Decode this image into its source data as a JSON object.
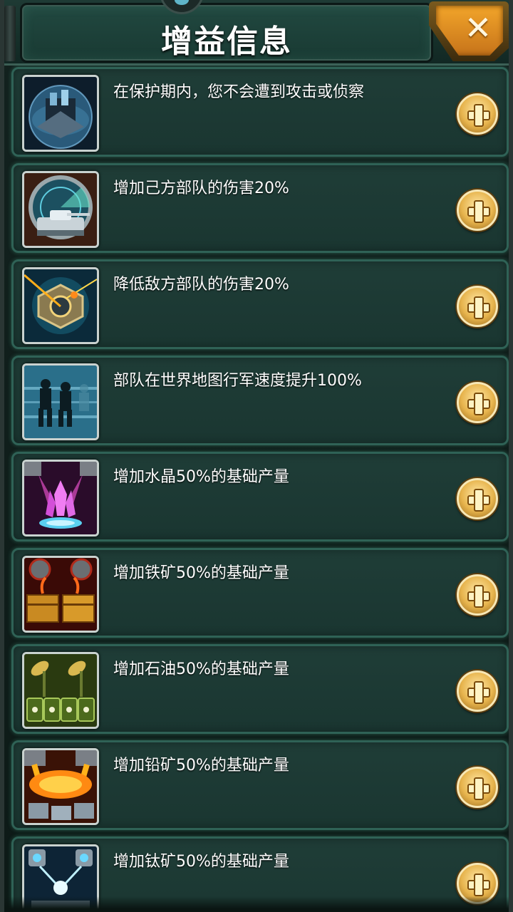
{
  "header": {
    "title": "增益信息",
    "close_label": "✕"
  },
  "buffs": [
    {
      "icon": "fortress-shield-icon",
      "text": "在保护期内，您不会遭到攻击或侦察"
    },
    {
      "icon": "tank-radar-icon",
      "text": "增加己方部队的伤害20%"
    },
    {
      "icon": "laser-armor-icon",
      "text": "降低敌方部队的伤害20%"
    },
    {
      "icon": "soldiers-march-icon",
      "text": "部队在世界地图行军速度提升100%"
    },
    {
      "icon": "crystal-icon",
      "text": "增加水晶50%的基础产量"
    },
    {
      "icon": "iron-ore-icon",
      "text": "增加铁矿50%的基础产量"
    },
    {
      "icon": "oil-barrel-icon",
      "text": "增加石油50%的基础产量"
    },
    {
      "icon": "lead-ore-icon",
      "text": "增加铅矿50%的基础产量"
    },
    {
      "icon": "titanium-ore-icon",
      "text": "增加钛矿50%的基础产量"
    }
  ]
}
